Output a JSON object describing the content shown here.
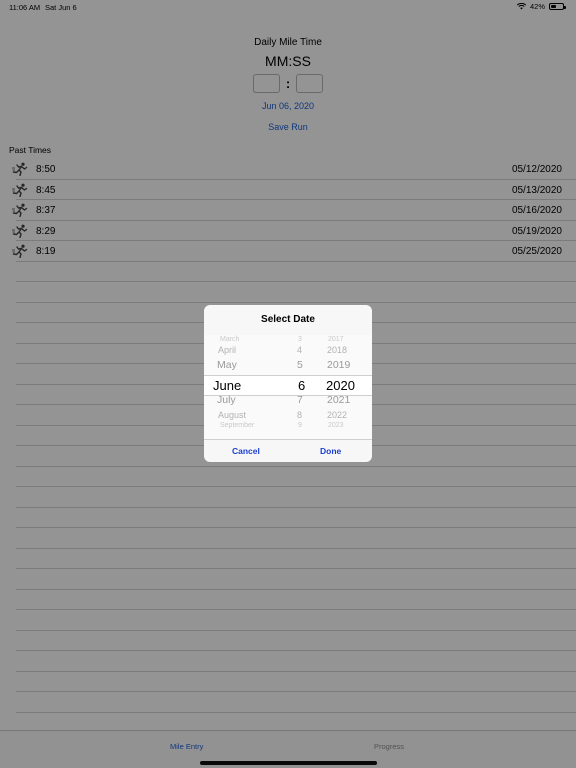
{
  "status_bar": {
    "time": "11:06 AM",
    "date": "Sat Jun 6",
    "battery": "42%"
  },
  "header": {
    "title": "Daily Mile Time",
    "format": "MM:SS",
    "separator": ":",
    "date": "Jun 06, 2020",
    "save_label": "Save Run"
  },
  "past": {
    "label": "Past Times",
    "rows": [
      {
        "time": "8:50",
        "date": "05/12/2020"
      },
      {
        "time": "8:45",
        "date": "05/13/2020"
      },
      {
        "time": "8:37",
        "date": "05/16/2020"
      },
      {
        "time": "8:29",
        "date": "05/19/2020"
      },
      {
        "time": "8:19",
        "date": "05/25/2020"
      }
    ]
  },
  "tabs": [
    {
      "label": "Mile Entry"
    },
    {
      "label": "Progress"
    }
  ],
  "dialog": {
    "title": "Select Date",
    "months": [
      "March",
      "April",
      "May",
      "June",
      "July",
      "August",
      "September"
    ],
    "days": [
      "3",
      "4",
      "5",
      "6",
      "7",
      "8",
      "9"
    ],
    "years": [
      "2017",
      "2018",
      "2019",
      "2020",
      "2021",
      "2022",
      "2023"
    ],
    "cancel_label": "Cancel",
    "done_label": "Done"
  },
  "icons": {
    "run": "runner-icon",
    "wifi": "wifi-icon",
    "battery": "battery-icon"
  },
  "colors": {
    "accent": "#1a5fd6",
    "dialog_button": "#1a3fd0"
  }
}
